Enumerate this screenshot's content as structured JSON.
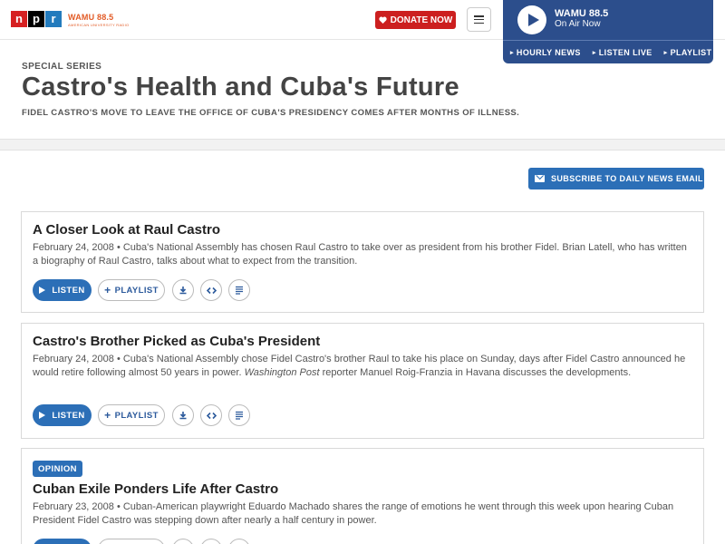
{
  "header": {
    "logo_letters": [
      "n",
      "p",
      "r"
    ],
    "station_logo": "WAMU 88.5",
    "station_logo_sub": "AMERICAN UNIVERSITY RADIO",
    "donate_label": "DONATE NOW",
    "menu_icon": "hamburger-icon"
  },
  "player": {
    "station": "WAMU 88.5",
    "status": "On Air Now",
    "links": [
      "HOURLY NEWS",
      "LISTEN LIVE",
      "PLAYLIST"
    ]
  },
  "page": {
    "kicker": "SPECIAL SERIES",
    "title": "Castro's Health and Cuba's Future",
    "subtitle": "FIDEL CASTRO'S MOVE TO LEAVE THE OFFICE OF CUBA'S PRESIDENCY COMES AFTER MONTHS OF ILLNESS.",
    "subscribe_label": "SUBSCRIBE TO DAILY NEWS EMAIL"
  },
  "actions": {
    "listen": "LISTEN",
    "playlist": "PLAYLIST"
  },
  "stories": [
    {
      "title": "A Closer Look at Raul Castro",
      "date": "February 24, 2008",
      "teaser": " • Cuba's National Assembly has chosen Raul Castro to take over as president from his brother Fidel. Brian Latell, who has written a biography of Raul Castro, talks about what to expect from the transition."
    },
    {
      "title": "Castro's Brother Picked as Cuba's President",
      "date": "February 24, 2008",
      "teaser_a": " • Cuba's National Assembly chose Fidel Castro's brother Raul to take his place on Sunday, days after Fidel Castro announced he would retire following almost 50 years in power. ",
      "teaser_em": "Washington Post",
      "teaser_b": " reporter Manuel Roig-Franzia in Havana discusses the developments."
    },
    {
      "badge": "OPINION",
      "title": "Cuban Exile Ponders Life After Castro",
      "date": "February 23, 2008",
      "teaser": " • Cuban-American playwright Eduardo Machado shares the range of emotions he went through this week upon hearing Cuban President Fidel Castro was stepping down after nearly a half century in power."
    }
  ],
  "colors": {
    "npr_red": "#d62021",
    "npr_black": "#000000",
    "npr_blue": "#237bbd",
    "brand_blue": "#2c6fb7",
    "player_blue": "#2c4e8c",
    "donate_red": "#cc1f1f",
    "station_orange": "#e25b26"
  }
}
